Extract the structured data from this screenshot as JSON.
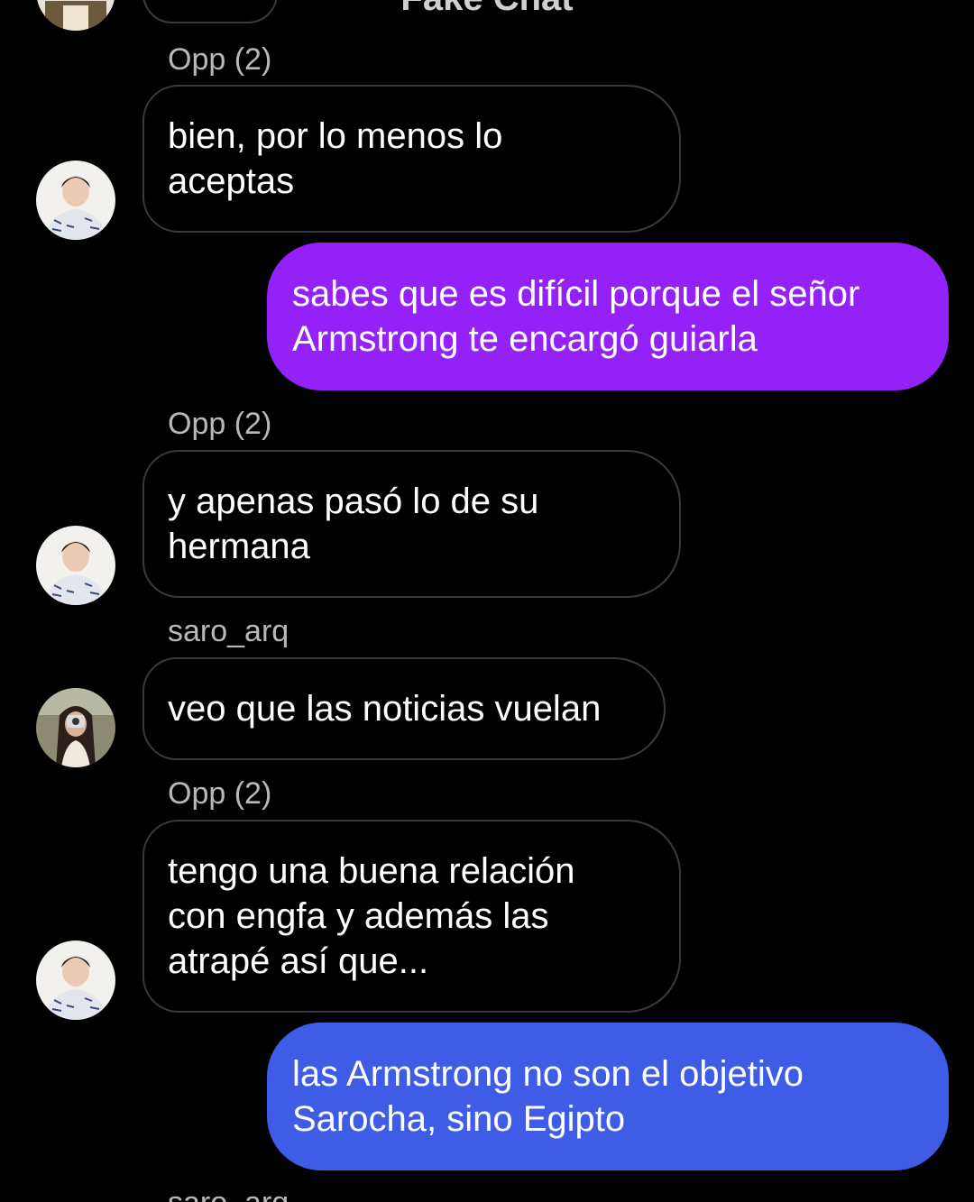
{
  "header": {
    "title": "Fake Chat"
  },
  "messages": [
    {
      "sender": "Opp (2)",
      "text": "bien, por lo menos lo aceptas"
    },
    {
      "text": "sabes que es difícil porque el señor Armstrong te encargó guiarla"
    },
    {
      "sender": "Opp (2)",
      "text": "y apenas pasó lo de su hermana"
    },
    {
      "sender": "saro_arq",
      "text": "veo que las noticias vuelan"
    },
    {
      "sender": "Opp (2)",
      "text": "tengo una buena relación con engfa y además las atrapé así que..."
    },
    {
      "text": "las Armstrong no son el objetivo Sarocha, sino Egipto"
    },
    {
      "sender": "saro_arq"
    }
  ],
  "colors": {
    "outgoing_purple": "#9321F8",
    "outgoing_blue": "#3F5CE6",
    "incoming_border": "#3a3a3a",
    "background": "#000000",
    "sender_label": "#b8b8b8"
  },
  "icons": {
    "avatar_opp": "avatar-opp-icon",
    "avatar_saro": "avatar-saro-icon"
  }
}
